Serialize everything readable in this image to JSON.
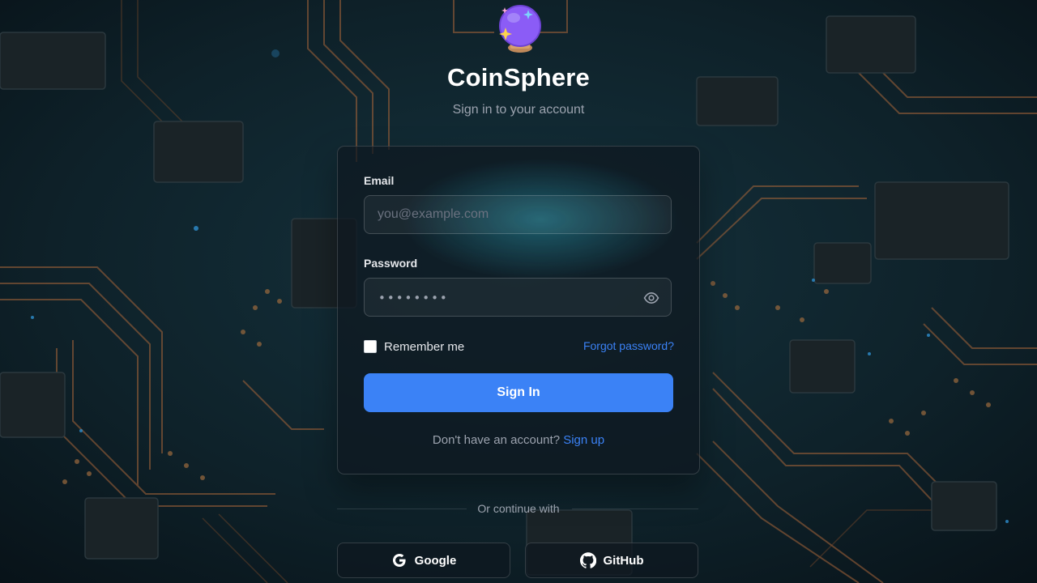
{
  "app": {
    "title": "CoinSphere",
    "subtitle": "Sign in to your account",
    "logo_icon": "crystal-ball-icon"
  },
  "form": {
    "email_label": "Email",
    "email_placeholder": "you@example.com",
    "email_value": "",
    "password_label": "Password",
    "password_masked": "••••••••",
    "password_toggle_icon": "eye-icon",
    "remember_label": "Remember me",
    "remember_checked": false,
    "forgot_label": "Forgot password?",
    "submit_label": "Sign In",
    "signup_prompt": "Don't have an account?",
    "signup_link": "Sign up"
  },
  "social": {
    "divider_text": "Or continue with",
    "google_label": "Google",
    "google_icon": "google-icon",
    "github_label": "GitHub",
    "github_icon": "github-icon"
  },
  "colors": {
    "accent": "#3b82f6",
    "background": "#0c1a22",
    "card": "#0e1820"
  }
}
